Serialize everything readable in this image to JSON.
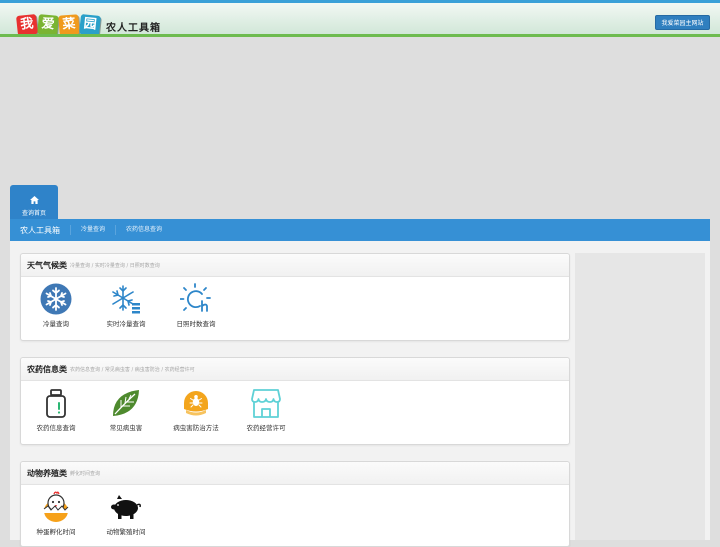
{
  "header": {
    "logo_chars": [
      "我",
      "爱",
      "菜",
      "园"
    ],
    "logo_subtitle": "农人工具箱",
    "main_site_button": "我爱菜园主网站"
  },
  "home_tab": {
    "label": "查询首页"
  },
  "nav": {
    "brand": "农人工具箱",
    "links": [
      "冷量查询",
      "农药信息查询"
    ]
  },
  "sections": [
    {
      "title": "天气气候类",
      "subtitle": "冷量查询 / 实时冷量查询 / 日照时数查询",
      "tools": [
        {
          "label": "冷量查询",
          "icon": "snowflake-icon"
        },
        {
          "label": "实时冷量查询",
          "icon": "snow-chart-icon"
        },
        {
          "label": "日照时数查询",
          "icon": "sun-hour-icon"
        }
      ]
    },
    {
      "title": "农药信息类",
      "subtitle": "农药信息查询 / 常见病虫害 / 病虫害防治 / 农药经营许可",
      "tools": [
        {
          "label": "农药信息查询",
          "icon": "pesticide-bottle-icon"
        },
        {
          "label": "常见病虫害",
          "icon": "leaf-icon"
        },
        {
          "label": "病虫害防治方法",
          "icon": "bug-badge-icon"
        },
        {
          "label": "农药经营许可",
          "icon": "shop-icon"
        }
      ]
    },
    {
      "title": "动物养殖类",
      "subtitle": "孵化时间查询",
      "tools": [
        {
          "label": "种蛋孵化时间",
          "icon": "hatching-egg-icon"
        },
        {
          "label": "动物繁殖时间",
          "icon": "pig-icon"
        }
      ]
    }
  ],
  "colors": {
    "accent_blue": "#3690d5",
    "header_green": "#6dbb4f",
    "snowflake": "#3f78b5",
    "leaf": "#4e8a2e",
    "orange": "#f3a51d",
    "shop_cyan": "#5fd1d6"
  }
}
